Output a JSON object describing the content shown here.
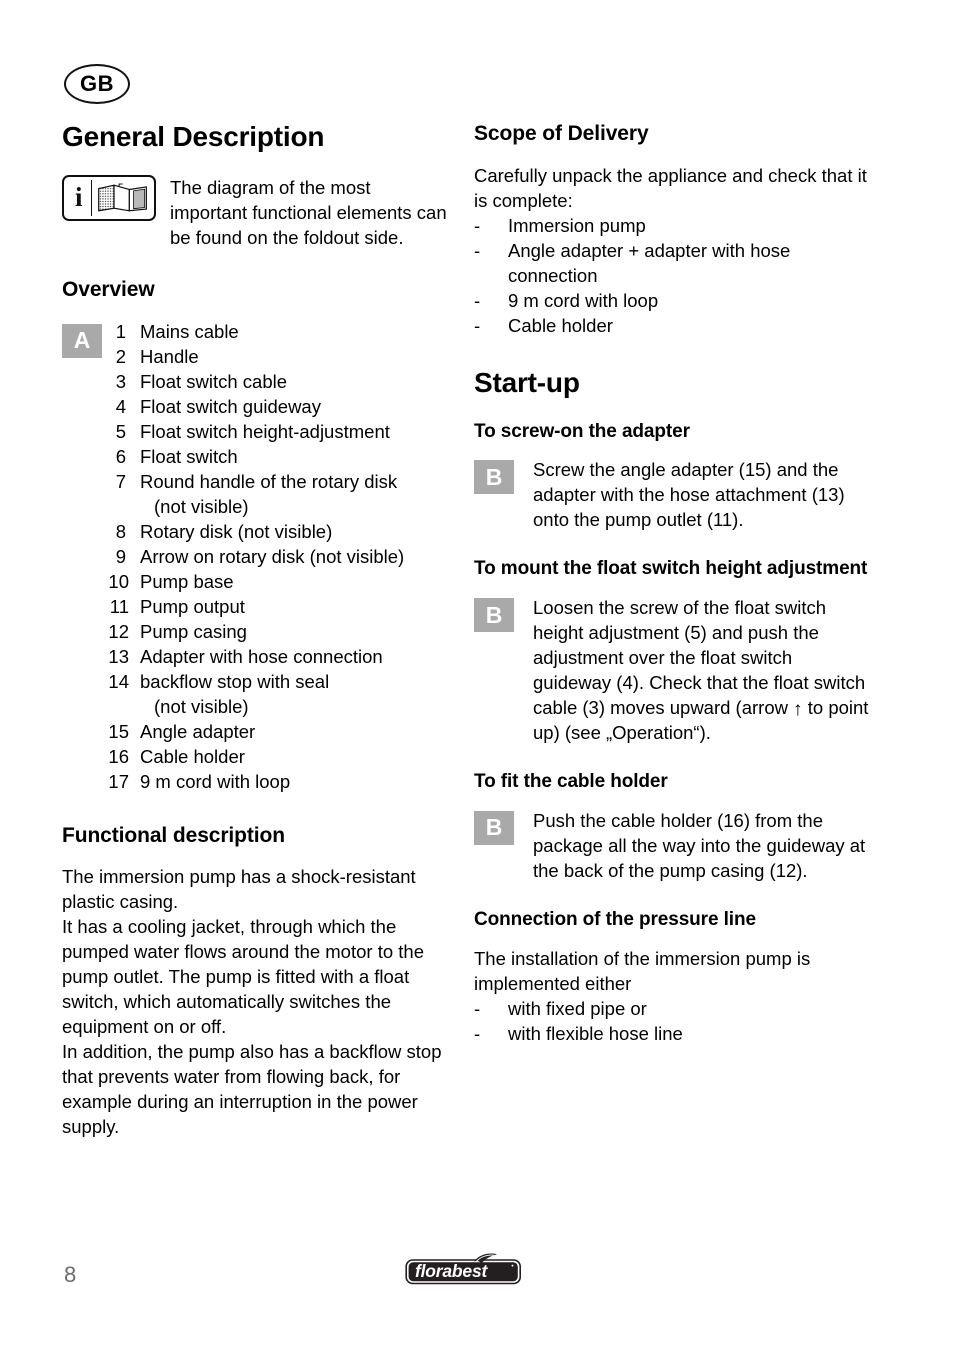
{
  "page": {
    "country_code": "GB",
    "page_number": "8",
    "brand": "florabest"
  },
  "left_column": {
    "title": "General Description",
    "info_callout": {
      "icon": "info-book-icon",
      "text": "The diagram of the most important functional elements can be found on the foldout side."
    },
    "overview": {
      "heading": "Overview",
      "badge": "A",
      "items": [
        {
          "num": "1",
          "label": "Mains cable"
        },
        {
          "num": "2",
          "label": "Handle"
        },
        {
          "num": "3",
          "label": "Float switch cable"
        },
        {
          "num": "4",
          "label": "Float switch guideway"
        },
        {
          "num": "5",
          "label": "Float switch height-adjustment"
        },
        {
          "num": "6",
          "label": "Float switch"
        },
        {
          "num": "7",
          "label": "Round handle of the rotary disk",
          "cont": "(not visible)"
        },
        {
          "num": "8",
          "label": "Rotary disk (not visible)"
        },
        {
          "num": "9",
          "label": "Arrow on rotary disk (not visible)"
        },
        {
          "num": "10",
          "label": "Pump base"
        },
        {
          "num": "11",
          "label": "Pump output"
        },
        {
          "num": "12",
          "label": "Pump casing"
        },
        {
          "num": "13",
          "label": "Adapter with hose connection"
        },
        {
          "num": "14",
          "label": "backflow stop with seal",
          "cont": "(not visible)"
        },
        {
          "num": "15",
          "label": "Angle adapter"
        },
        {
          "num": "16",
          "label": "Cable holder"
        },
        {
          "num": "17",
          "label": "9 m cord with loop"
        }
      ]
    },
    "functional_description": {
      "heading": "Functional description",
      "paragraphs": [
        "The immersion pump has a shock-resistant plastic casing.",
        "It has a cooling jacket, through which the pumped water flows around the motor to the pump outlet. The pump is fitted with a float switch, which automatically switches the equipment on or off.",
        "In addition, the pump also has a backflow stop that prevents water from flowing back, for example during an interruption in the power supply."
      ]
    }
  },
  "right_column": {
    "scope_of_delivery": {
      "heading": "Scope of Delivery",
      "intro": "Carefully unpack the appliance and check that it is complete:",
      "dash": "-",
      "items": [
        "Immersion pump",
        "Angle adapter + adapter with hose connection",
        "9 m cord with loop",
        "Cable holder"
      ]
    },
    "start_up": {
      "heading": "Start-up",
      "blocks": [
        {
          "subheading": "To screw-on the adapter",
          "badge": "B",
          "text": "Screw the angle adapter (15) and the adapter with the hose attachment (13) onto the pump outlet (11)."
        },
        {
          "subheading": "To mount the float switch height adjustment",
          "badge": "B",
          "text_before_arrow": "Loosen the screw of the float switch height adjustment (5) and push the adjustment over the float switch guideway (4). Check that the float switch cable (3) moves upward (arrow ",
          "arrow": "↑",
          "text_after_arrow": " to point up) (see „Operation“)."
        },
        {
          "subheading": "To fit the cable holder",
          "badge": "B",
          "text": "Push the cable holder (16) from the package all the way into the guideway at the back of the pump casing (12)."
        }
      ]
    },
    "pressure_line": {
      "heading": "Connection of the pressure line",
      "intro": "The installation of the immersion pump is implemented either",
      "dash": "-",
      "items": [
        "with fixed pipe or",
        "with flexible hose line"
      ]
    }
  },
  "colors": {
    "badge_gray": "#a9a9a9",
    "page_number_gray": "#6b6b6b",
    "logo_dark": "#231f20"
  }
}
